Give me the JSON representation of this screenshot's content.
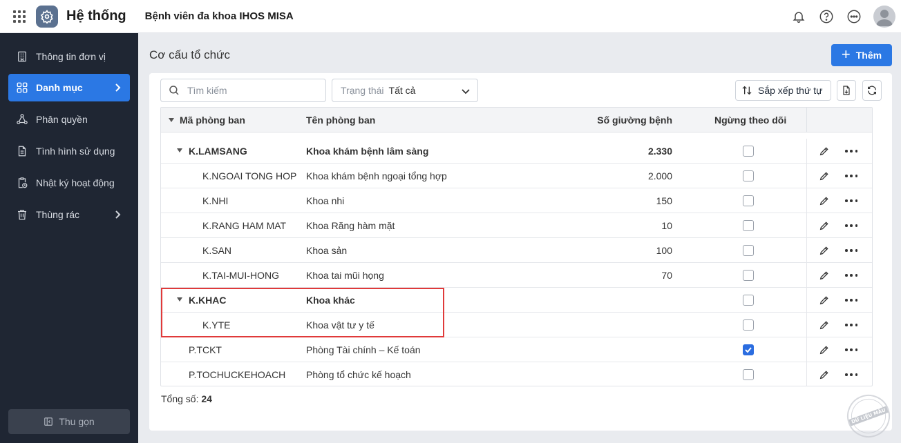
{
  "header": {
    "app_title": "Hệ thống",
    "org_name": "Bệnh viên đa khoa IHOS MISA"
  },
  "sidebar": {
    "items": [
      {
        "label": "Thông tin đơn vị"
      },
      {
        "label": "Danh mục"
      },
      {
        "label": "Phân quyền"
      },
      {
        "label": "Tình hình sử dụng"
      },
      {
        "label": "Nhật ký hoạt động"
      },
      {
        "label": "Thùng rác"
      }
    ],
    "collapse_label": "Thu gọn"
  },
  "page": {
    "title": "Cơ cấu tổ chức",
    "add_label": "Thêm"
  },
  "toolbar": {
    "search_placeholder": "Tìm kiếm",
    "status_label": "Trạng thái",
    "status_value": "Tất cả",
    "sort_label": "Sắp xếp thứ tự"
  },
  "table": {
    "headers": {
      "code": "Mã phòng ban",
      "name": "Tên phòng ban",
      "beds": "Số giường bệnh",
      "stopped": "Ngừng theo dõi"
    },
    "rows": [
      {
        "code": "K.LAMSANG",
        "name": "Khoa khám bệnh lâm sàng",
        "beds": "2.330",
        "stopped": false
      },
      {
        "code": "K.NGOAI TONG HOP",
        "name": "Khoa khám bệnh ngoại tổng hợp",
        "beds": "2.000",
        "stopped": false
      },
      {
        "code": "K.NHI",
        "name": "Khoa nhi",
        "beds": "150",
        "stopped": false
      },
      {
        "code": "K.RANG HAM MAT",
        "name": "Khoa Răng hàm mặt",
        "beds": "10",
        "stopped": false
      },
      {
        "code": "K.SAN",
        "name": "Khoa sản",
        "beds": "100",
        "stopped": false
      },
      {
        "code": "K.TAI-MUI-HONG",
        "name": "Khoa tai mũi họng",
        "beds": "70",
        "stopped": false
      },
      {
        "code": "K.KHAC",
        "name": "Khoa khác",
        "beds": "",
        "stopped": false
      },
      {
        "code": "K.YTE",
        "name": "Khoa vật tư y tế",
        "beds": "",
        "stopped": false
      },
      {
        "code": "P.TCKT",
        "name": "Phòng Tài chính – Kế toán",
        "beds": "",
        "stopped": true
      },
      {
        "code": "P.TOCHUCKEHOACH",
        "name": "Phòng tổ chức kế hoạch",
        "beds": "",
        "stopped": false
      }
    ]
  },
  "footer": {
    "total_label": "Tổng số:",
    "total_value": "24"
  },
  "watermark": "DỮ LIỆU MẪU",
  "colors": {
    "accent": "#2b78e4",
    "sidebar_bg": "#1f2633",
    "highlight_border": "#e03a3a"
  }
}
